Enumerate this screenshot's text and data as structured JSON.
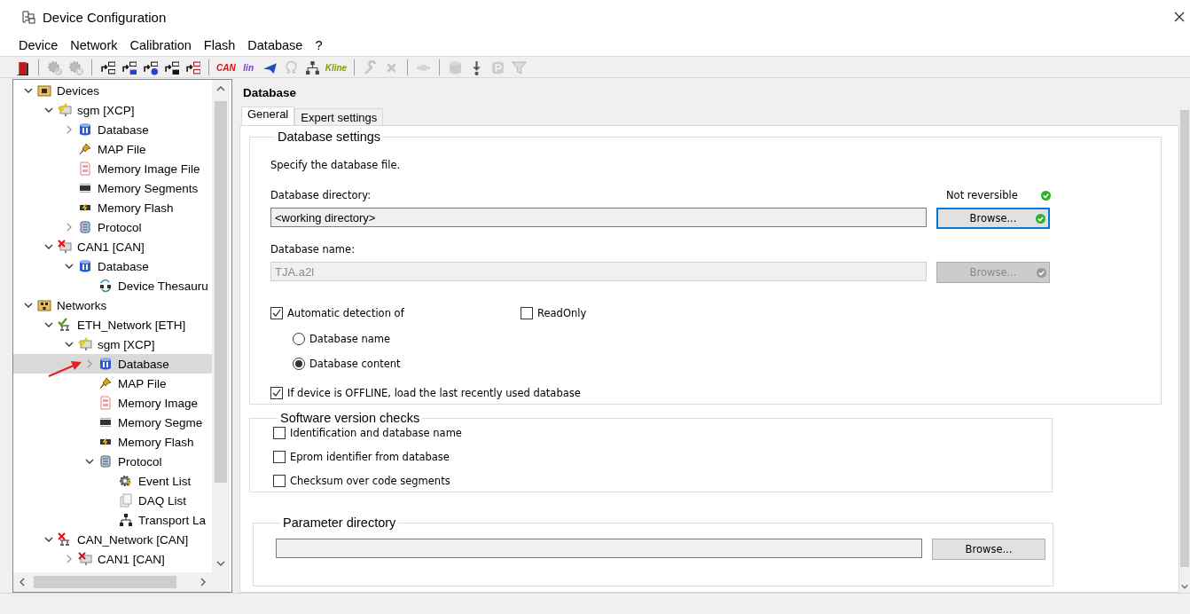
{
  "window": {
    "title": "Device Configuration"
  },
  "menu": [
    "Device",
    "Network",
    "Calibration",
    "Flash",
    "Database",
    "?"
  ],
  "toolbar": [
    {
      "kind": "exit",
      "disabled": false
    },
    {
      "kind": "separator"
    },
    {
      "kind": "gear-check",
      "disabled": true
    },
    {
      "kind": "gear-cross",
      "disabled": true
    },
    {
      "kind": "separator"
    },
    {
      "kind": "tree-arrow",
      "disabled": false
    },
    {
      "kind": "tree-arrow-blue",
      "disabled": false
    },
    {
      "kind": "tree-arrow-globe",
      "disabled": false
    },
    {
      "kind": "tree-arrow-grid",
      "disabled": false
    },
    {
      "kind": "tree-arrow-red",
      "disabled": false
    },
    {
      "kind": "separator"
    },
    {
      "kind": "text",
      "label": "CAN",
      "color": "#e01010",
      "disabled": false
    },
    {
      "kind": "text",
      "label": "lin",
      "color": "#7a3cc8",
      "disabled": false
    },
    {
      "kind": "plane",
      "disabled": false
    },
    {
      "kind": "omega",
      "disabled": true
    },
    {
      "kind": "network",
      "disabled": false
    },
    {
      "kind": "text",
      "label": "Kline",
      "color": "#8a9a10",
      "disabled": false
    },
    {
      "kind": "separator"
    },
    {
      "kind": "wrench",
      "disabled": true
    },
    {
      "kind": "cross",
      "disabled": true
    },
    {
      "kind": "separator"
    },
    {
      "kind": "connector",
      "disabled": true
    },
    {
      "kind": "separator"
    },
    {
      "kind": "db",
      "disabled": true
    },
    {
      "kind": "download",
      "disabled": false
    },
    {
      "kind": "parking",
      "disabled": true
    },
    {
      "kind": "filter",
      "disabled": true
    }
  ],
  "tree": [
    {
      "label": "Devices",
      "kind": "folder",
      "expanded": true,
      "selected": false,
      "children": [
        {
          "label": "sgm [XCP]",
          "kind": "device-ok",
          "expanded": true,
          "selected": false,
          "children": [
            {
              "label": "Database",
              "kind": "db",
              "expanded": false,
              "selected": false
            },
            {
              "label": "MAP File",
              "kind": "pin",
              "selected": false
            },
            {
              "label": "Memory Image File",
              "kind": "memimg",
              "selected": false
            },
            {
              "label": "Memory Segments",
              "kind": "chip",
              "selected": false
            },
            {
              "label": "Memory Flash",
              "kind": "flash",
              "selected": false
            },
            {
              "label": "Protocol",
              "kind": "protocol",
              "expanded": false,
              "selected": false
            }
          ]
        },
        {
          "label": "CAN1 [CAN]",
          "kind": "device-err",
          "expanded": true,
          "selected": false,
          "children": [
            {
              "label": "Database",
              "kind": "db",
              "expanded": true,
              "selected": false,
              "children": [
                {
                  "label": "Device Thesauru",
                  "kind": "thesaurus",
                  "selected": false
                }
              ]
            }
          ]
        }
      ]
    },
    {
      "label": "Networks",
      "kind": "netfolder",
      "expanded": true,
      "selected": false,
      "children": [
        {
          "label": "ETH_Network [ETH]",
          "kind": "net-ok",
          "expanded": true,
          "selected": false,
          "children": [
            {
              "label": "sgm [XCP]",
              "kind": "device-ok",
              "expanded": true,
              "selected": false,
              "children": [
                {
                  "label": "Database",
                  "kind": "db",
                  "expanded": false,
                  "selected": true
                },
                {
                  "label": "MAP File",
                  "kind": "pin",
                  "selected": false
                },
                {
                  "label": "Memory Image",
                  "kind": "memimg",
                  "selected": false
                },
                {
                  "label": "Memory Segme",
                  "kind": "chip",
                  "selected": false
                },
                {
                  "label": "Memory Flash",
                  "kind": "flash",
                  "selected": false
                },
                {
                  "label": "Protocol",
                  "kind": "protocol",
                  "expanded": true,
                  "selected": false,
                  "children": [
                    {
                      "label": "Event List",
                      "kind": "gear",
                      "selected": false
                    },
                    {
                      "label": "DAQ List",
                      "kind": "pages",
                      "selected": false
                    },
                    {
                      "label": "Transport La",
                      "kind": "network",
                      "selected": false
                    }
                  ]
                }
              ]
            }
          ]
        },
        {
          "label": "CAN_Network [CAN]",
          "kind": "net-err",
          "expanded": true,
          "selected": false,
          "children": [
            {
              "label": "CAN1 [CAN]",
              "kind": "device-err",
              "expanded": false,
              "selected": false
            }
          ]
        }
      ]
    }
  ],
  "panel": {
    "title": "Database",
    "tabs": [
      {
        "label": "General",
        "selected": true
      },
      {
        "label": "Expert settings",
        "selected": false
      }
    ],
    "database_settings": {
      "title": "Database settings",
      "hint": "Specify the database file.",
      "directory": {
        "label": "Database directory:",
        "status": "Not reversible",
        "value": "<working directory>",
        "button": "Browse...",
        "disabled": false
      },
      "name": {
        "label": "Database name:",
        "value": "TJA.a2l",
        "button": "Browse...",
        "disabled": true
      },
      "auto_detect": {
        "label": "Automatic detection of",
        "checked": true
      },
      "read_only": {
        "label": "ReadOnly",
        "checked": false
      },
      "detect_options": [
        {
          "label": "Database name",
          "selected": false
        },
        {
          "label": "Database content",
          "selected": true
        }
      ],
      "offline": {
        "label": "If device is OFFLINE, load the last recently used database",
        "checked": true
      }
    },
    "software_checks": {
      "title": "Software version checks",
      "items": [
        {
          "label": "Identification and database name",
          "checked": false
        },
        {
          "label": "Eprom identifier from database",
          "checked": false
        },
        {
          "label": "Checksum over code segments",
          "checked": false
        }
      ]
    },
    "parameter_directory": {
      "title": "Parameter directory",
      "button": "Browse..."
    }
  }
}
